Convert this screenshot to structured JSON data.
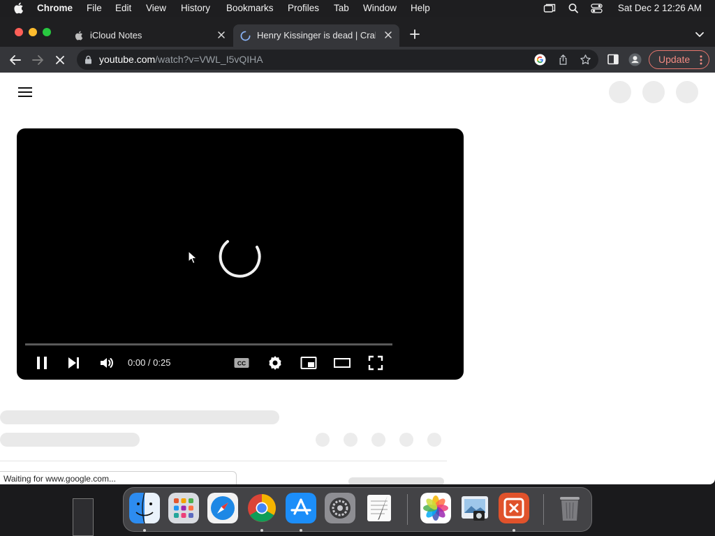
{
  "menubar": {
    "app_name": "Chrome",
    "items": [
      "File",
      "Edit",
      "View",
      "History",
      "Bookmarks",
      "Profiles",
      "Tab",
      "Window",
      "Help"
    ],
    "clock": "Sat Dec 2  12:26 AM",
    "icons": [
      "apple-icon",
      "screen-mirroring-icon",
      "spotlight-search-icon",
      "control-center-icon"
    ]
  },
  "tabs": [
    {
      "title": "iCloud Notes",
      "icon": "apple-icon",
      "active": false
    },
    {
      "title": "Henry Kissinger is dead | Crab",
      "icon": "loading-spinner-icon",
      "active": true
    }
  ],
  "toolbar": {
    "url_domain": "youtube.com",
    "url_path": "/watch?v=VWL_I5vQIHA",
    "update_label": "Update"
  },
  "player": {
    "time": "0:00 / 0:25",
    "progress_fraction": 0.0
  },
  "status": {
    "text": "Waiting for www.google.com..."
  },
  "dock": {
    "apps": [
      "Finder",
      "Launchpad",
      "Safari",
      "Google Chrome",
      "App Store",
      "System Settings",
      "TextEdit",
      "Photos",
      "Preview",
      "Microsoft Remote Desktop",
      "Trash"
    ]
  },
  "colors": {
    "update_accent": "#f28b82",
    "progress_red": "#ff0000"
  }
}
